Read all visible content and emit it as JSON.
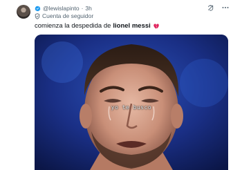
{
  "post": {
    "handle": "@lewislapinto",
    "separator": "·",
    "time": "3h",
    "follower_label": "Cuenta de seguidor",
    "text_prefix": "comienza la despedida de",
    "text_bold": "lionel messi",
    "text_emoji": "broken-heart",
    "media_caption": "yo te busco"
  },
  "icons": {
    "verified": "verified-badge-icon",
    "shield": "shield-icon",
    "grok": "grok-icon",
    "more": "more-icon",
    "heart": "broken-heart-icon"
  },
  "colors": {
    "accent": "#1d9bf0",
    "secondary_text": "#536471",
    "primary_text": "#0f1419",
    "heart": "#e0245e"
  }
}
